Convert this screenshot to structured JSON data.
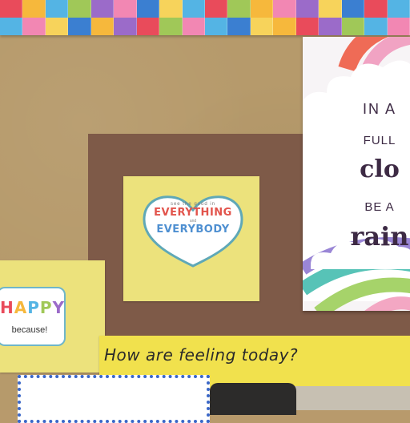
{
  "scene": "classroom-bulletin-board",
  "border": {
    "colors": [
      "c1",
      "c2",
      "c3",
      "c4",
      "c5",
      "c6",
      "c7",
      "c8",
      "c3",
      "c1",
      "c4",
      "c2",
      "c6",
      "c5",
      "c8",
      "c7",
      "c1",
      "c3"
    ],
    "colors_row2": [
      "c3",
      "c6",
      "c8",
      "c7",
      "c2",
      "c5",
      "c1",
      "c4",
      "c6",
      "c3",
      "c7",
      "c8",
      "c2",
      "c1",
      "c5",
      "c4",
      "c3",
      "c6"
    ]
  },
  "heart_sign": {
    "small_text": "see the good in",
    "line1": "EVERYTHING",
    "and_text": "and",
    "line2": "EVERYBODY"
  },
  "happy_sign": {
    "word": "HAPPY",
    "sub": "because!"
  },
  "poster": {
    "line1": "IN A",
    "line2": "FULL",
    "line3": "clo",
    "line4": "BE A",
    "line5": "rain"
  },
  "question": {
    "text": "How are feeling today?"
  }
}
